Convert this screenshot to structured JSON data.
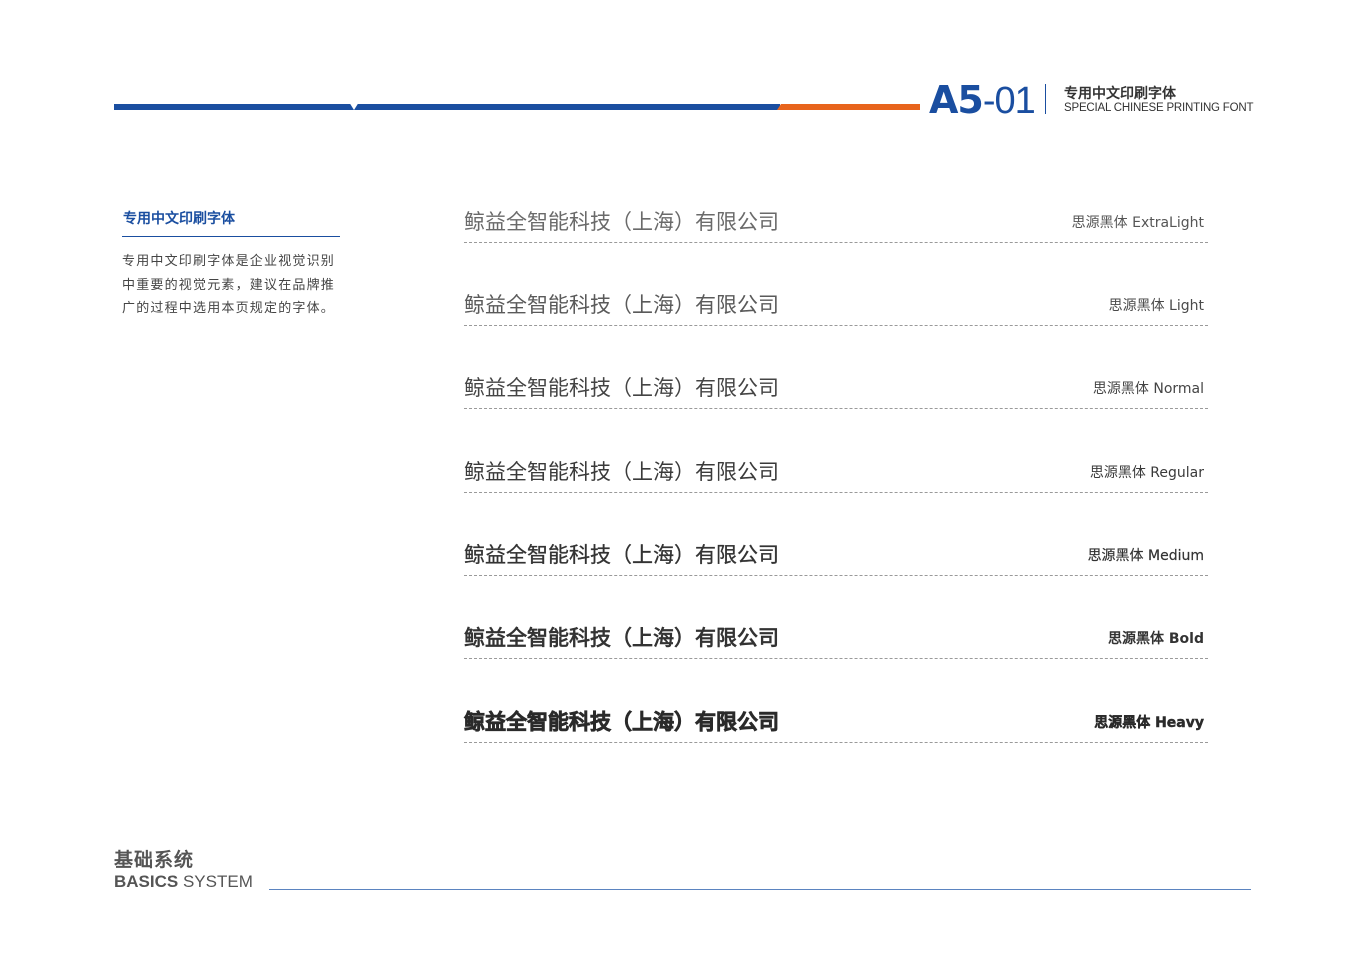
{
  "header": {
    "code_letters": "A5",
    "code_number": "-01",
    "title_cn": "专用中文印刷字体",
    "title_en": "SPECIAL CHINESE PRINTING FONT"
  },
  "colors": {
    "brand_blue": "#1a4ea0",
    "accent_orange": "#e8641c",
    "text": "#444444"
  },
  "sidebar": {
    "title": "专用中文印刷字体",
    "description": "专用中文印刷字体是企业视觉识别中重要的视觉元素，建议在品牌推广的过程中选用本页规定的字体。"
  },
  "specimens": [
    {
      "sample": "鲸益全智能科技（上海）有限公司",
      "weight": "思源黑体 ExtraLight"
    },
    {
      "sample": "鲸益全智能科技（上海）有限公司",
      "weight": "思源黑体 Light"
    },
    {
      "sample": "鲸益全智能科技（上海）有限公司",
      "weight": "思源黑体 Normal"
    },
    {
      "sample": "鲸益全智能科技（上海）有限公司",
      "weight": "思源黑体 Regular"
    },
    {
      "sample": "鲸益全智能科技（上海）有限公司",
      "weight": "思源黑体 Medium"
    },
    {
      "sample": "鲸益全智能科技（上海）有限公司",
      "weight": "思源黑体 Bold"
    },
    {
      "sample": "鲸益全智能科技（上海）有限公司",
      "weight": "思源黑体 Heavy"
    }
  ],
  "footer": {
    "title_cn": "基础系统",
    "title_en_bold": "BASICS",
    "title_en_light": " SYSTEM"
  }
}
